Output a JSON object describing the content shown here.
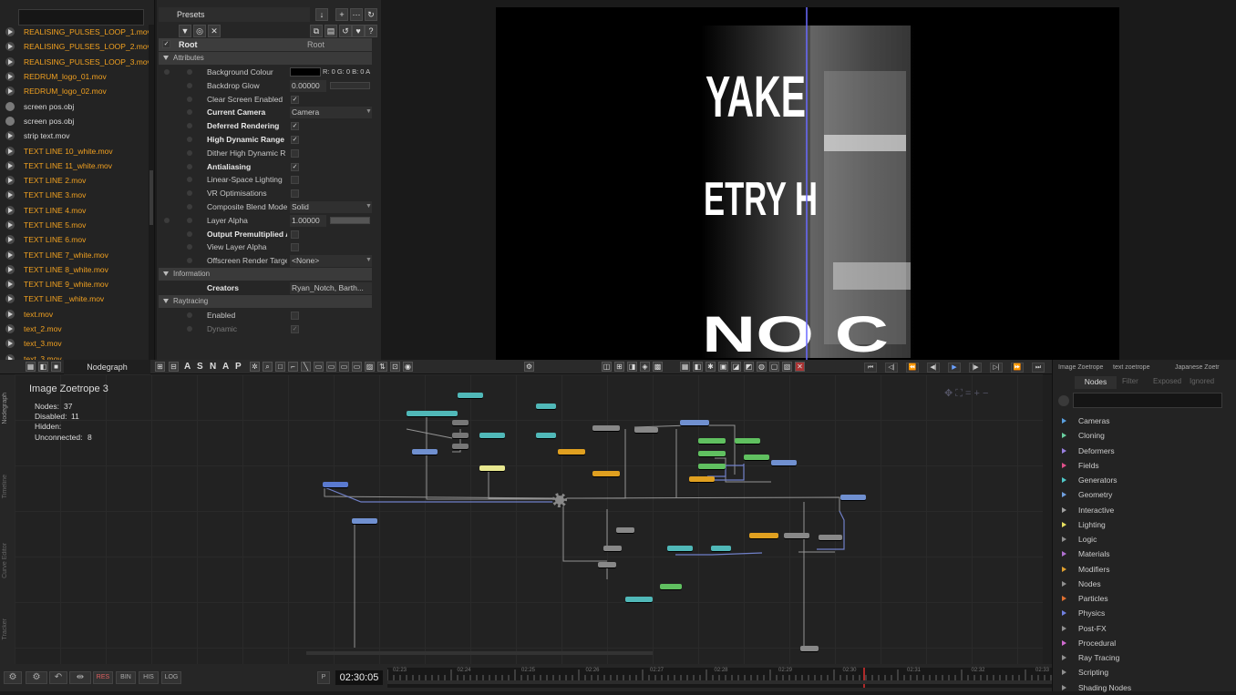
{
  "resources": {
    "items": [
      {
        "label": "REALISING_PULSES_LOOP_1.mov",
        "kind": "video",
        "color": "orange"
      },
      {
        "label": "REALISING_PULSES_LOOP_2.mov",
        "kind": "video",
        "color": "orange"
      },
      {
        "label": "REALISING_PULSES_LOOP_3.mov",
        "kind": "video",
        "color": "orange"
      },
      {
        "label": "REDRUM_logo_01.mov",
        "kind": "video",
        "color": "orange"
      },
      {
        "label": "REDRUM_logo_02.mov",
        "kind": "video",
        "color": "orange"
      },
      {
        "label": "screen pos.obj",
        "kind": "object",
        "color": "white"
      },
      {
        "label": "screen pos.obj",
        "kind": "object",
        "color": "white"
      },
      {
        "label": "strip text.mov",
        "kind": "video",
        "color": "white"
      },
      {
        "label": "TEXT LINE 10_white.mov",
        "kind": "video",
        "color": "orange"
      },
      {
        "label": "TEXT LINE 11_white.mov",
        "kind": "video",
        "color": "orange"
      },
      {
        "label": "TEXT LINE 2.mov",
        "kind": "video",
        "color": "orange"
      },
      {
        "label": "TEXT LINE 3.mov",
        "kind": "video",
        "color": "orange"
      },
      {
        "label": "TEXT LINE 4.mov",
        "kind": "video",
        "color": "orange"
      },
      {
        "label": "TEXT LINE 5.mov",
        "kind": "video",
        "color": "orange"
      },
      {
        "label": "TEXT LINE 6.mov",
        "kind": "video",
        "color": "orange"
      },
      {
        "label": "TEXT LINE 7_white.mov",
        "kind": "video",
        "color": "orange"
      },
      {
        "label": "TEXT LINE 8_white.mov",
        "kind": "video",
        "color": "orange"
      },
      {
        "label": "TEXT LINE 9_white.mov",
        "kind": "video",
        "color": "orange"
      },
      {
        "label": "TEXT LINE _white.mov",
        "kind": "video",
        "color": "orange"
      },
      {
        "label": "text.mov",
        "kind": "video",
        "color": "orange"
      },
      {
        "label": "text_2.mov",
        "kind": "video",
        "color": "orange"
      },
      {
        "label": "text_3.mov",
        "kind": "video",
        "color": "orange"
      },
      {
        "label": "text_3.mov",
        "kind": "video",
        "color": "orange"
      }
    ]
  },
  "properties": {
    "presets_label": "Presets",
    "root_label": "Root",
    "root_value": "Root",
    "sections": {
      "attributes": "Attributes",
      "information": "Information",
      "raytracing": "Raytracing"
    },
    "rows": [
      {
        "label": "Background Colour",
        "value": "R: 0 G: 0 B: 0 A",
        "type": "color",
        "bold": false
      },
      {
        "label": "Backdrop Glow",
        "value": "0.00000",
        "type": "number",
        "bold": false
      },
      {
        "label": "Clear Screen Enabled",
        "value": "✓",
        "type": "check",
        "bold": false
      },
      {
        "label": "Current Camera",
        "value": "Camera",
        "type": "select",
        "bold": true
      },
      {
        "label": "Deferred Rendering",
        "value": "✓",
        "type": "check",
        "bold": true
      },
      {
        "label": "High Dynamic Range",
        "value": "✓",
        "type": "check",
        "bold": true
      },
      {
        "label": "Dither High Dynamic R",
        "value": "",
        "type": "check",
        "bold": false
      },
      {
        "label": "Antialiasing",
        "value": "✓",
        "type": "check",
        "bold": true
      },
      {
        "label": "Linear-Space Lighting",
        "value": "",
        "type": "check",
        "bold": false
      },
      {
        "label": "VR Optimisations",
        "value": "",
        "type": "check",
        "bold": false
      },
      {
        "label": "Composite Blend Mode",
        "value": "Solid",
        "type": "select",
        "bold": false
      },
      {
        "label": "Layer Alpha",
        "value": "1.00000",
        "type": "number",
        "bold": false
      },
      {
        "label": "Output Premultiplied A",
        "value": "",
        "type": "check",
        "bold": true
      },
      {
        "label": "View Layer Alpha",
        "value": "",
        "type": "check",
        "bold": false
      },
      {
        "label": "Offscreen Render Targe",
        "value": "<None>",
        "type": "select",
        "bold": false
      }
    ],
    "info_rows": [
      {
        "label": "Creators",
        "value": "Ryan_Notch, Barth..."
      }
    ],
    "ray_rows": [
      {
        "label": "Enabled",
        "value": ""
      },
      {
        "label": "Dynamic",
        "value": "✓"
      }
    ]
  },
  "nodegraph": {
    "tab": "Nodegraph",
    "toolbar_letters": [
      "A",
      "S",
      "N",
      "A",
      "P"
    ],
    "title": "Image  Zoetrope  3",
    "stats": [
      {
        "k": "Nodes:",
        "v": "37"
      },
      {
        "k": "Disabled:",
        "v": "11"
      },
      {
        "k": "Hidden:",
        "v": ""
      },
      {
        "k": "Unconnected:",
        "v": "8"
      }
    ],
    "side_tabs": [
      "Nodegraph",
      "Timeline",
      "Curve Editor",
      "Tracker"
    ],
    "bottom_buttons": [
      "RES",
      "BIN",
      "HIS",
      "LOG"
    ],
    "timecode": "02:30:05",
    "ruler_ticks": [
      "02:23",
      "02:24",
      "02:25",
      "02:26",
      "02:27",
      "02:28",
      "02:29",
      "02:30",
      "02:31",
      "02:32",
      "02:33"
    ],
    "transport": [
      "⏮",
      "◁|",
      "⏪",
      "◀|",
      "▶",
      "|▶",
      "▷|",
      "⏩",
      "⏭"
    ]
  },
  "nodes_panel": {
    "tabs": [
      "Image Zoetrope",
      "text zoetrope",
      "Japanese Zoetr"
    ],
    "subtabs": [
      "Nodes",
      "Filter",
      "Exposed",
      "Ignored"
    ],
    "categories": [
      {
        "label": "Cameras",
        "color": "#5aa0e0"
      },
      {
        "label": "Cloning",
        "color": "#6ad0a0"
      },
      {
        "label": "Deformers",
        "color": "#9a80e0"
      },
      {
        "label": "Fields",
        "color": "#e0508a"
      },
      {
        "label": "Generators",
        "color": "#50c8c8"
      },
      {
        "label": "Geometry",
        "color": "#70a0e0"
      },
      {
        "label": "Interactive",
        "color": "#a0a0a0"
      },
      {
        "label": "Lighting",
        "color": "#e8e060"
      },
      {
        "label": "Logic",
        "color": "#909090"
      },
      {
        "label": "Materials",
        "color": "#b070d0"
      },
      {
        "label": "Modifiers",
        "color": "#e0a030"
      },
      {
        "label": "Nodes",
        "color": "#909090"
      },
      {
        "label": "Particles",
        "color": "#e07030"
      },
      {
        "label": "Physics",
        "color": "#7080e0"
      },
      {
        "label": "Post-FX",
        "color": "#909090"
      },
      {
        "label": "Procedural",
        "color": "#d06ad0"
      },
      {
        "label": "Ray Tracing",
        "color": "#909090"
      },
      {
        "label": "Scripting",
        "color": "#909090"
      },
      {
        "label": "Shading Nodes",
        "color": "#909090"
      }
    ]
  },
  "viewport": {
    "render_text": [
      "YAKE",
      "ETRY H",
      "NO C"
    ]
  }
}
